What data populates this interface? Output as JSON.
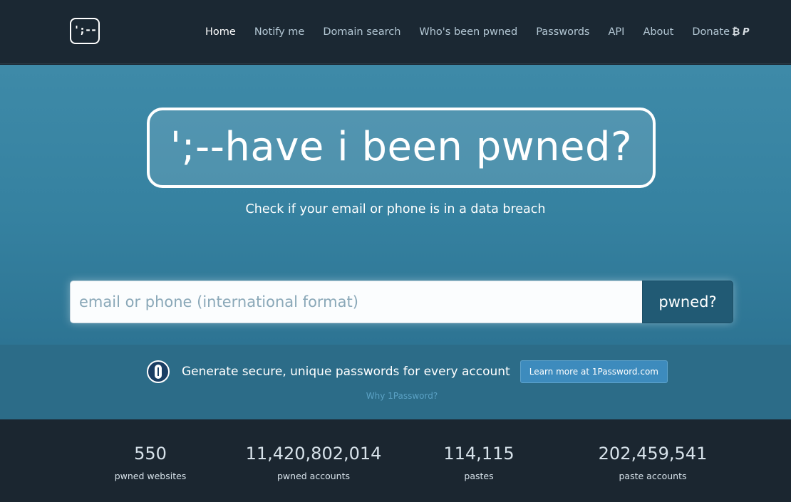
{
  "nav": {
    "logo_text": "';--",
    "items": [
      {
        "label": "Home",
        "active": true
      },
      {
        "label": "Notify me"
      },
      {
        "label": "Domain search"
      },
      {
        "label": "Who's been pwned"
      },
      {
        "label": "Passwords"
      },
      {
        "label": "API"
      },
      {
        "label": "About"
      },
      {
        "label": "Donate"
      }
    ],
    "donate_icons": [
      "bitcoin-icon",
      "paypal-icon"
    ]
  },
  "hero": {
    "title": "';--have i been pwned?",
    "subtitle": "Check if your email or phone is in a data breach",
    "search": {
      "placeholder": "email or phone (international format)",
      "value": "",
      "button_label": "pwned?"
    },
    "colors": {
      "hero_bg": "#3581a0",
      "button_bg": "#215a74"
    }
  },
  "promo": {
    "icon": "1password-icon",
    "text": "Generate secure, unique passwords for every account",
    "button_label": "Learn more at 1Password.com",
    "link_label": "Why 1Password?"
  },
  "stats": [
    {
      "value": "550",
      "label": "pwned websites"
    },
    {
      "value": "11,420,802,014",
      "label": "pwned accounts"
    },
    {
      "value": "114,115",
      "label": "pastes"
    },
    {
      "value": "202,459,541",
      "label": "paste accounts"
    }
  ]
}
